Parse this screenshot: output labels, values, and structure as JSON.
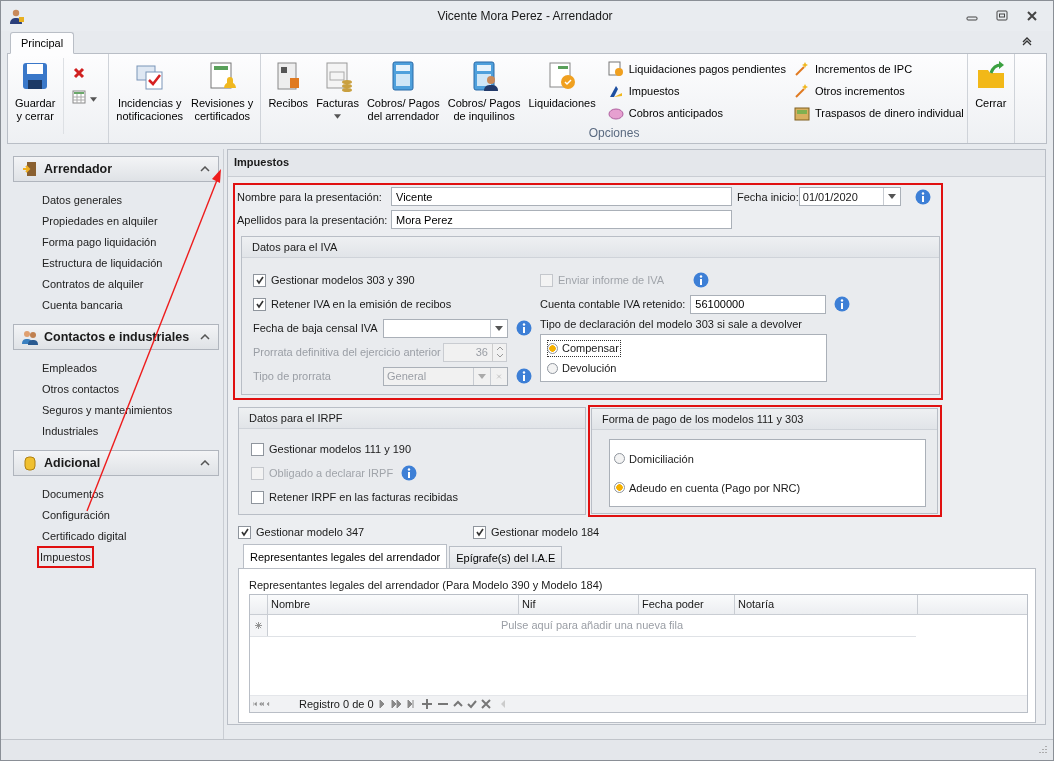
{
  "window": {
    "title": "Vicente Mora Perez - Arrendador"
  },
  "ribbon": {
    "tabs": [
      {
        "label": "Principal",
        "selected": true
      }
    ],
    "groups": [
      {
        "large": [
          {
            "lines": [
              "Guardar",
              "y cerrar"
            ],
            "dropdown": false
          }
        ],
        "small_icons": [
          {
            "dropdown": false
          },
          {
            "dropdown": true
          }
        ]
      },
      {
        "large": [
          {
            "lines": [
              "Incidencias y",
              "notificaciones"
            ],
            "dropdown": false
          },
          {
            "lines": [
              "Revisiones y",
              "certificados"
            ],
            "dropdown": false
          }
        ]
      },
      {
        "title": "Opciones",
        "large": [
          {
            "lines": [
              "Recibos"
            ],
            "dropdown": false
          },
          {
            "lines": [
              "Facturas"
            ],
            "dropdown": true
          },
          {
            "lines": [
              "Cobros/ Pagos",
              "del arrendador"
            ],
            "dropdown": false
          },
          {
            "lines": [
              "Cobros/ Pagos",
              "de inquilinos"
            ],
            "dropdown": false
          },
          {
            "lines": [
              "Liquidaciones"
            ],
            "dropdown": false
          }
        ],
        "columns": [
          [
            "Liquidaciones pagos pendientes",
            "Impuestos",
            "Cobros anticipados"
          ],
          [
            "Incrementos de IPC",
            "Otros incrementos",
            "Traspasos de dinero individual"
          ]
        ]
      },
      {
        "large": [
          {
            "lines": [
              "Cerrar"
            ],
            "dropdown": false
          }
        ]
      }
    ]
  },
  "sidebar": {
    "sections": [
      {
        "title": "Arrendador",
        "expanded": true,
        "items": [
          {
            "label": "Datos generales",
            "annotated": false
          },
          {
            "label": "Propiedades en alquiler",
            "annotated": false
          },
          {
            "label": "Forma pago liquidación",
            "annotated": false
          },
          {
            "label": "Estructura de liquidación",
            "annotated": false
          },
          {
            "label": "Contratos de alquiler",
            "annotated": false
          },
          {
            "label": "Cuenta bancaria",
            "annotated": false
          }
        ]
      },
      {
        "title": "Contactos e industriales",
        "expanded": true,
        "items": [
          {
            "label": "Empleados",
            "annotated": false
          },
          {
            "label": "Otros contactos",
            "annotated": false
          },
          {
            "label": "Seguros y mantenimientos",
            "annotated": false
          },
          {
            "label": "Industriales",
            "annotated": false
          }
        ]
      },
      {
        "title": "Adicional",
        "expanded": true,
        "items": [
          {
            "label": "Documentos",
            "annotated": false
          },
          {
            "label": "Configuración",
            "annotated": false
          },
          {
            "label": "Certificado digital",
            "annotated": false
          },
          {
            "label": "Impuestos",
            "annotated": true
          }
        ]
      }
    ]
  },
  "panel": {
    "title": "Impuestos",
    "nombre": {
      "label": "Nombre para la presentación:",
      "value": "Vicente"
    },
    "fecha_inicio": {
      "label": "Fecha inicio:",
      "value": "01/01/2020"
    },
    "apellidos": {
      "label": "Apellidos para la presentación:",
      "value": "Mora Perez"
    },
    "iva": {
      "title": "Datos para el IVA",
      "checks": [
        {
          "label": "Gestionar modelos 303 y 390",
          "checked": true,
          "disabled": false
        },
        {
          "label": "Retener IVA en la emisión de recibos",
          "checked": true,
          "disabled": false
        }
      ],
      "fecha_baja": {
        "label": "Fecha de baja censal IVA"
      },
      "prorrata": {
        "label": "Prorrata definitiva del ejercicio anterior",
        "value": "36",
        "disabled": true
      },
      "tipo_prorrata": {
        "label": "Tipo de prorrata",
        "value": "General",
        "disabled": true
      },
      "enviar_informe": {
        "label": "Enviar informe de IVA",
        "checked": false,
        "disabled": true
      },
      "cuenta": {
        "label": "Cuenta contable IVA retenido:",
        "value": "56100000"
      },
      "declaracion": {
        "label": "Tipo de declaración del modelo 303 si sale a devolver",
        "options": [
          {
            "label": "Compensar",
            "selected": true
          },
          {
            "label": "Devolución",
            "selected": false
          }
        ]
      }
    },
    "irpf": {
      "title": "Datos para el IRPF",
      "checks": [
        {
          "label": "Gestionar modelos 111 y 190",
          "checked": false,
          "disabled": false,
          "info": false
        },
        {
          "label": "Obligado a declarar IRPF",
          "checked": false,
          "disabled": true,
          "info": true
        },
        {
          "label": "Retener IRPF en las facturas recibidas",
          "checked": false,
          "disabled": false,
          "info": false
        }
      ]
    },
    "forma_pago": {
      "title": "Forma de pago de los modelos 111 y 303",
      "options": [
        {
          "label": "Domiciliación",
          "selected": false
        },
        {
          "label": "Adeudo en cuenta (Pago por NRC)",
          "selected": true
        }
      ]
    },
    "model_checks": [
      {
        "label": "Gestionar modelo 347",
        "checked": true
      },
      {
        "label": "Gestionar modelo 184",
        "checked": true
      }
    ],
    "tabs": [
      {
        "label": "Representantes legales del arrendador",
        "selected": true
      },
      {
        "label": "Epígrafe(s) del I.A.E",
        "selected": false
      }
    ],
    "grid": {
      "caption": "Representantes legales del arrendador (Para Modelo 390 y Modelo 184)",
      "columns": [
        "Nombre",
        "Nif",
        "Fecha poder",
        "Notaría"
      ],
      "new_row": "Pulse aquí para añadir una nueva fila",
      "navigator": "Registro 0 de 0"
    }
  }
}
